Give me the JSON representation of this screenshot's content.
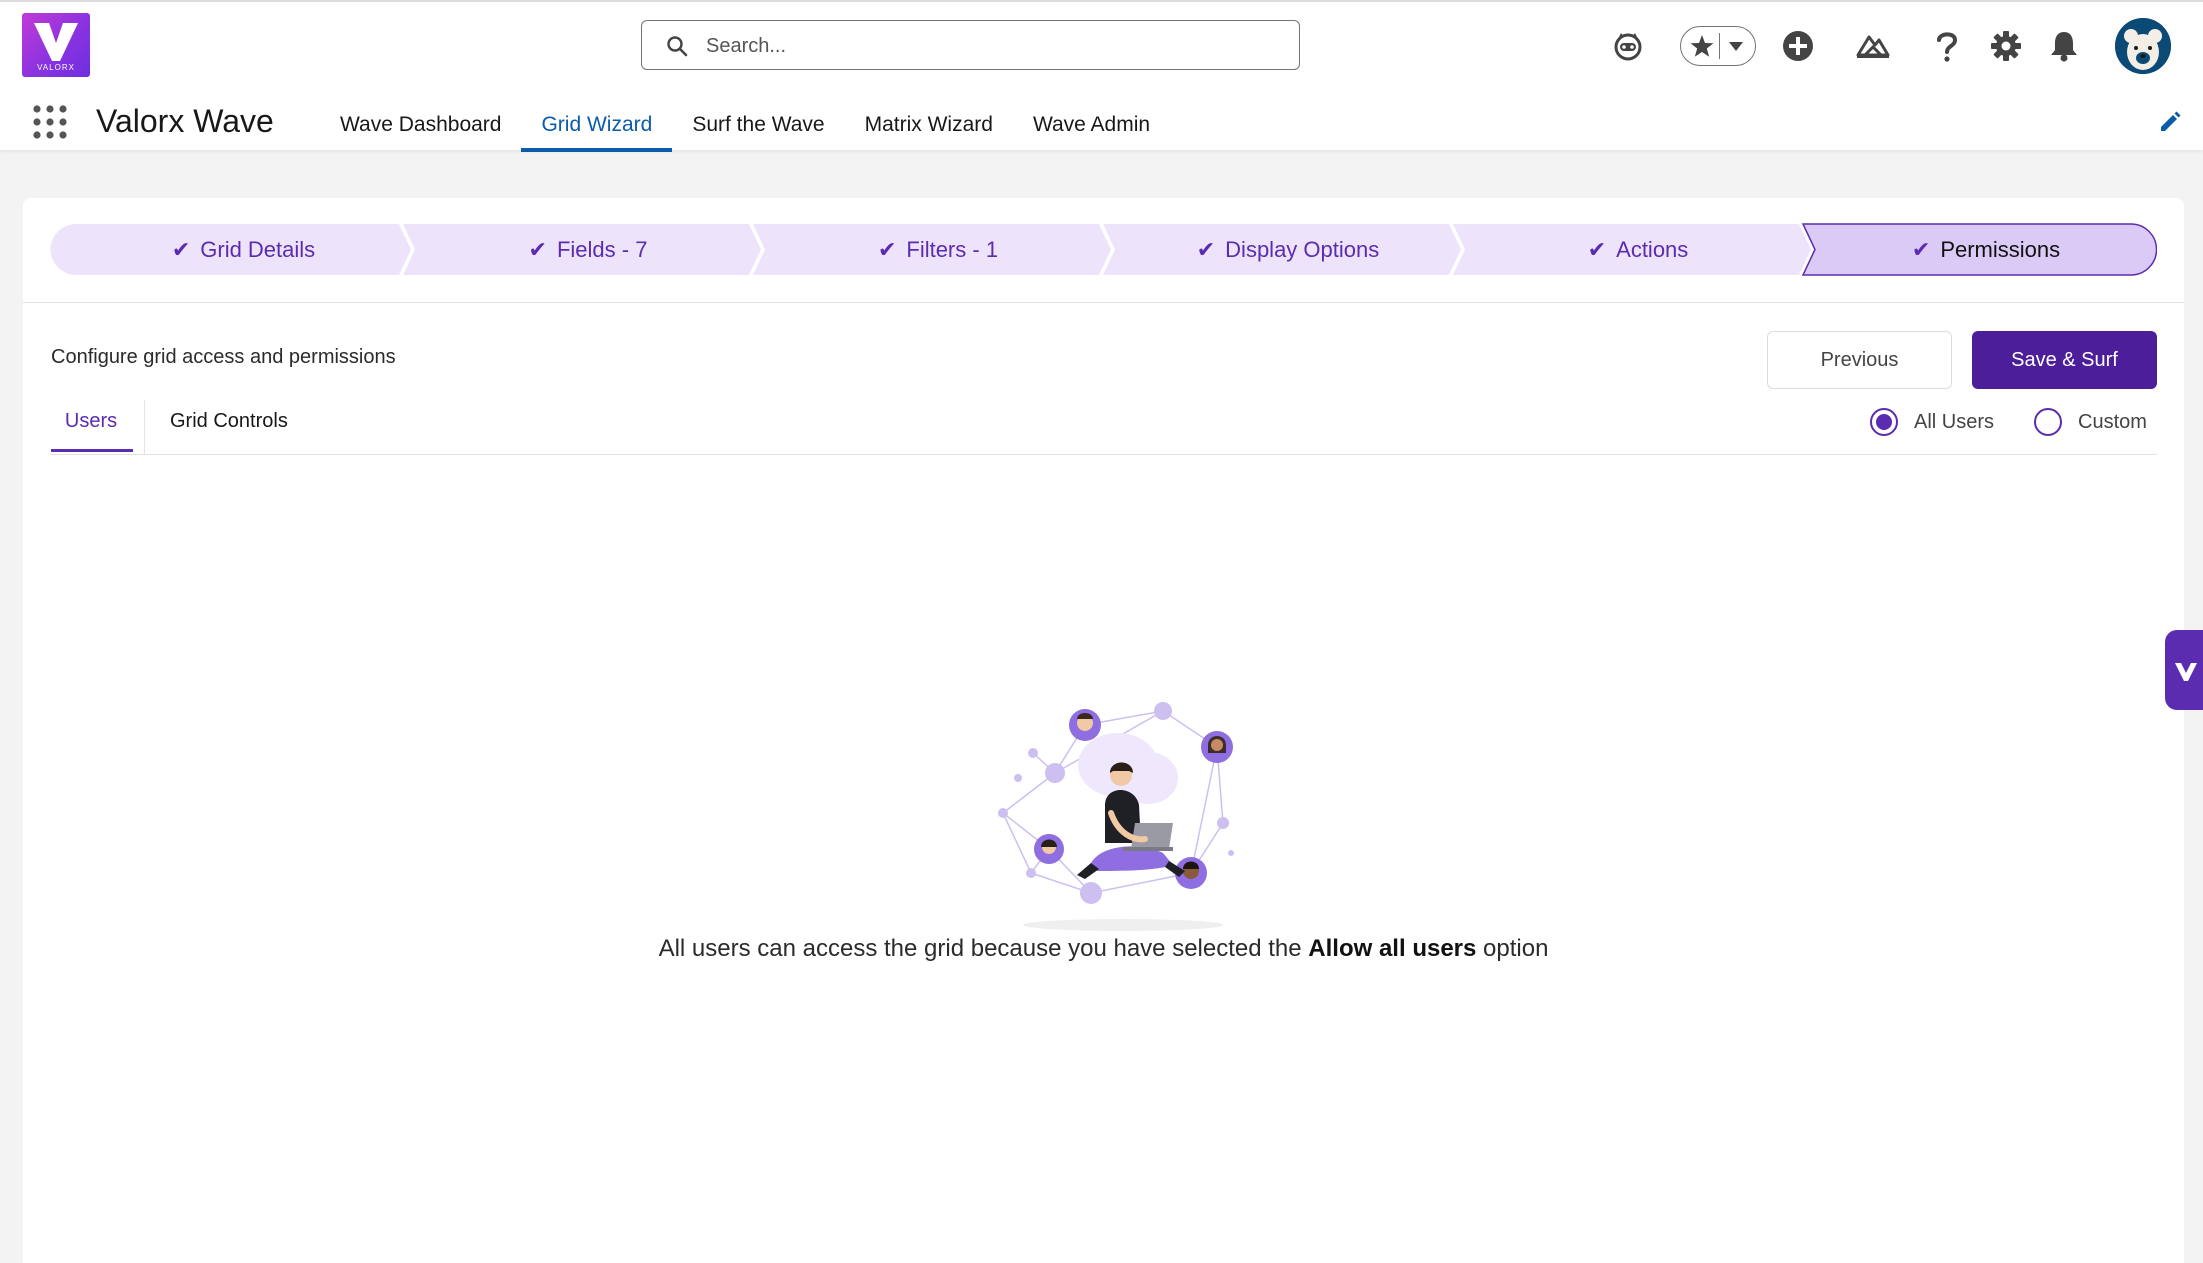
{
  "header": {
    "logo_text": "VALORX",
    "search_placeholder": "Search...",
    "app_name": "Valorx Wave",
    "icons": [
      "astro-icon",
      "favorites-star-icon",
      "favorites-dropdown-icon",
      "add-icon",
      "trailhead-icon",
      "help-icon",
      "settings-gear-icon",
      "notifications-bell-icon",
      "user-avatar"
    ]
  },
  "nav": {
    "items": [
      {
        "label": "Wave Dashboard"
      },
      {
        "label": "Grid Wizard"
      },
      {
        "label": "Surf the Wave"
      },
      {
        "label": "Matrix Wizard"
      },
      {
        "label": "Wave Admin"
      }
    ],
    "active": "Grid Wizard"
  },
  "wizard": {
    "stages": [
      {
        "label": "Grid Details",
        "done": true
      },
      {
        "label": "Fields - 7",
        "done": true
      },
      {
        "label": "Filters - 1",
        "done": true
      },
      {
        "label": "Display Options",
        "done": true
      },
      {
        "label": "Actions",
        "done": true
      },
      {
        "label": "Permissions",
        "done": true,
        "active": true
      }
    ],
    "subtitle": "Configure grid access and permissions",
    "previous_label": "Previous",
    "save_label": "Save & Surf",
    "tabs": [
      {
        "label": "Users",
        "active": true
      },
      {
        "label": "Grid Controls",
        "active": false
      }
    ],
    "access_options": [
      {
        "label": "All Users",
        "selected": true
      },
      {
        "label": "Custom",
        "selected": false
      }
    ],
    "empty_state": {
      "prefix": "All users can access the grid because you have selected the ",
      "emphasis": "Allow all users",
      "suffix": " option"
    }
  },
  "colors": {
    "accent": "#5b2bb0",
    "primary_button": "#4d1e9a",
    "stage_fill": "#ede4fb",
    "stage_active_fill": "#dccaf6",
    "nav_active": "#0b5cab"
  }
}
